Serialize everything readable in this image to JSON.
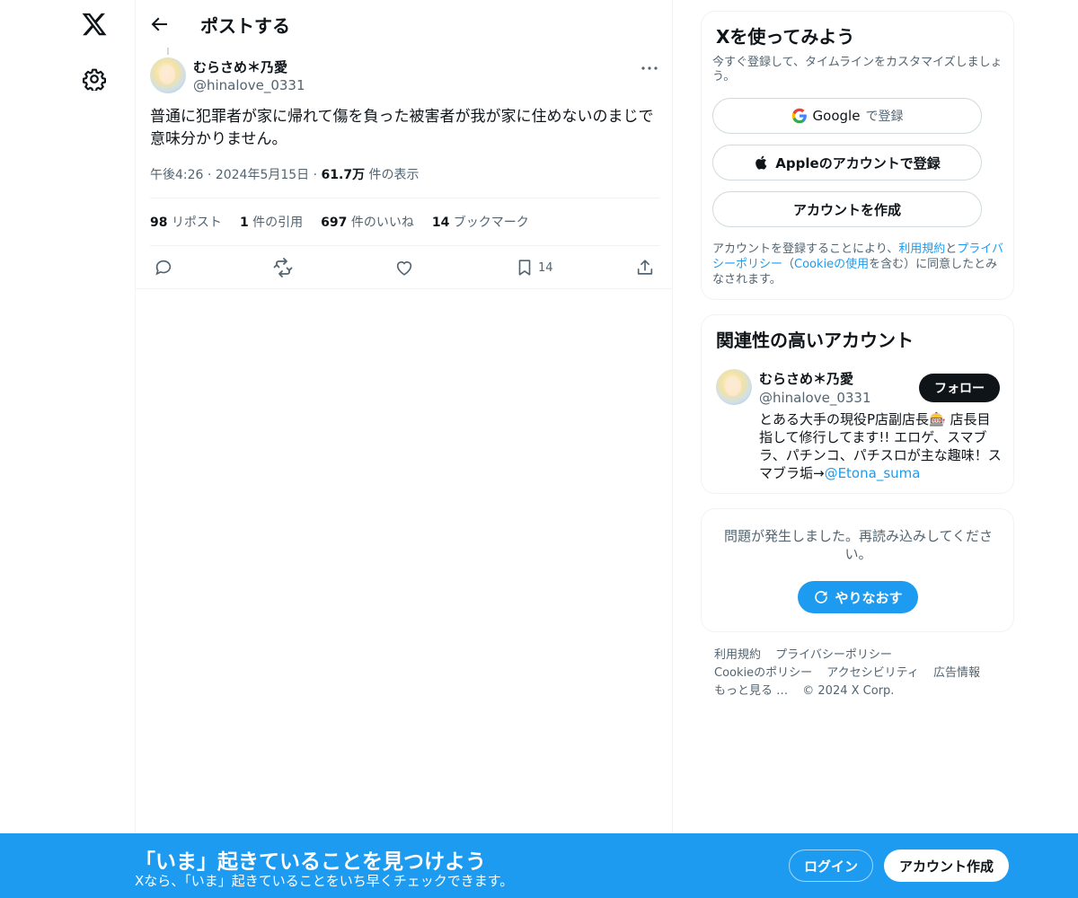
{
  "nav": {
    "logo_icon": "x-logo-icon",
    "settings_icon": "gear-icon"
  },
  "header": {
    "title": "ポストする",
    "back_icon": "arrow-left-icon"
  },
  "post": {
    "author_name": "むらさめ＊乃愛",
    "author_handle": "@hinalove_0331",
    "text": "普通に犯罪者が家に帰れて傷を負った被害者が我が家に住めないのまじで意味分かりません。",
    "time": "午後4:26",
    "date": "2024年5月15日",
    "views_count": "61.7万",
    "views_label": "件の表示",
    "stats": {
      "reposts_count": "98",
      "reposts_label": "リポスト",
      "quotes_count": "1",
      "quotes_label": "件の引用",
      "likes_count": "697",
      "likes_label": "件のいいね",
      "bookmarks_count": "14",
      "bookmarks_label": "ブックマーク"
    },
    "bookmark_action_count": "14"
  },
  "signup_card": {
    "title": "Xを使ってみよう",
    "subtitle": "今すぐ登録して、タイムラインをカスタマイズしましょう。",
    "google_label_brand": "Google",
    "google_label_rest": "で登録",
    "apple_label": "Appleのアカウントで登録",
    "create_label": "アカウントを作成",
    "legal_pre": "アカウントを登録することにより、",
    "legal_terms": "利用規約",
    "legal_and": "と",
    "legal_privacy": "プライバシーポリシー",
    "legal_mid1": "（",
    "legal_cookie": "Cookieの使用",
    "legal_post": "を含む）に同意したとみなされます。"
  },
  "related": {
    "title": "関連性の高いアカウント",
    "name": "むらさめ＊乃愛",
    "handle": "@hinalove_0331",
    "follow_label": "フォロー",
    "bio": "とある大手の現役P店副店長🎰 店長目指して修行してます!! エロゲ、スマブラ、パチンコ、パチスロが主な趣味！スマブラ垢→",
    "bio_link": "@Etona_suma"
  },
  "error_card": {
    "message": "問題が発生しました。再読み込みしてください。",
    "retry_label": "やりなおす"
  },
  "footer": {
    "links": [
      "利用規約",
      "プライバシーポリシー",
      "Cookieのポリシー",
      "アクセシビリティ",
      "広告情報",
      "もっと見る …"
    ],
    "copyright": "© 2024 X Corp."
  },
  "banner": {
    "title": "「いま」起きていることを見つけよう",
    "subtitle": "Xなら、「いま」起きていることをいち早くチェックできます。",
    "login_label": "ログイン",
    "signup_label": "アカウント作成"
  },
  "colors": {
    "accent": "#1d9bf0",
    "text": "#0f1419",
    "muted": "#536471",
    "border": "#eff3f4"
  }
}
